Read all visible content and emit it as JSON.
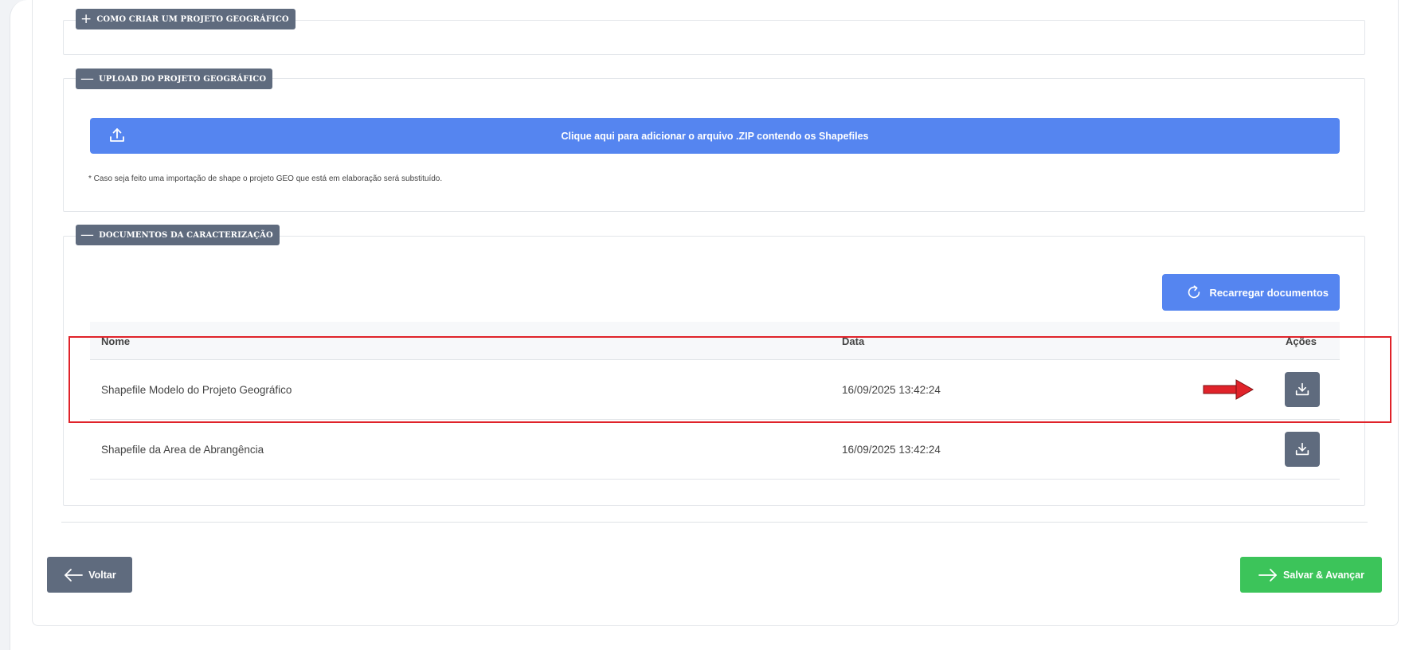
{
  "sections": {
    "how_to": {
      "label": "Como criar um projeto geográfico",
      "symbol": "+"
    },
    "upload": {
      "label": "Upload do projeto geográfico",
      "symbol": "—"
    },
    "documents": {
      "label": "Documentos da caracterização",
      "symbol": "—"
    }
  },
  "upload": {
    "button_label": "Clique aqui para adicionar o arquivo .ZIP contendo os Shapefiles",
    "icon": "upload-icon",
    "note": "* Caso seja feito uma importação de shape o projeto GEO que está em elaboração será substituído."
  },
  "documents": {
    "reload_label": "Recarregar documentos",
    "reload_icon": "refresh-icon",
    "columns": {
      "name": "Nome",
      "date": "Data",
      "actions": "Ações"
    },
    "rows": [
      {
        "name": "Shapefile Modelo do Projeto Geográfico",
        "date": "16/09/2025 13:42:24",
        "action_icon": "download-icon"
      },
      {
        "name": "Shapefile da Area de Abrangência",
        "date": "16/09/2025 13:42:24",
        "action_icon": "download-icon"
      }
    ]
  },
  "footer": {
    "back_label": "Voltar",
    "next_label": "Salvar & Avançar"
  },
  "colors": {
    "primary": "#5585f0",
    "secondary": "#5f6b7e",
    "success": "#3cc45a",
    "annotation": "#e0232a"
  }
}
